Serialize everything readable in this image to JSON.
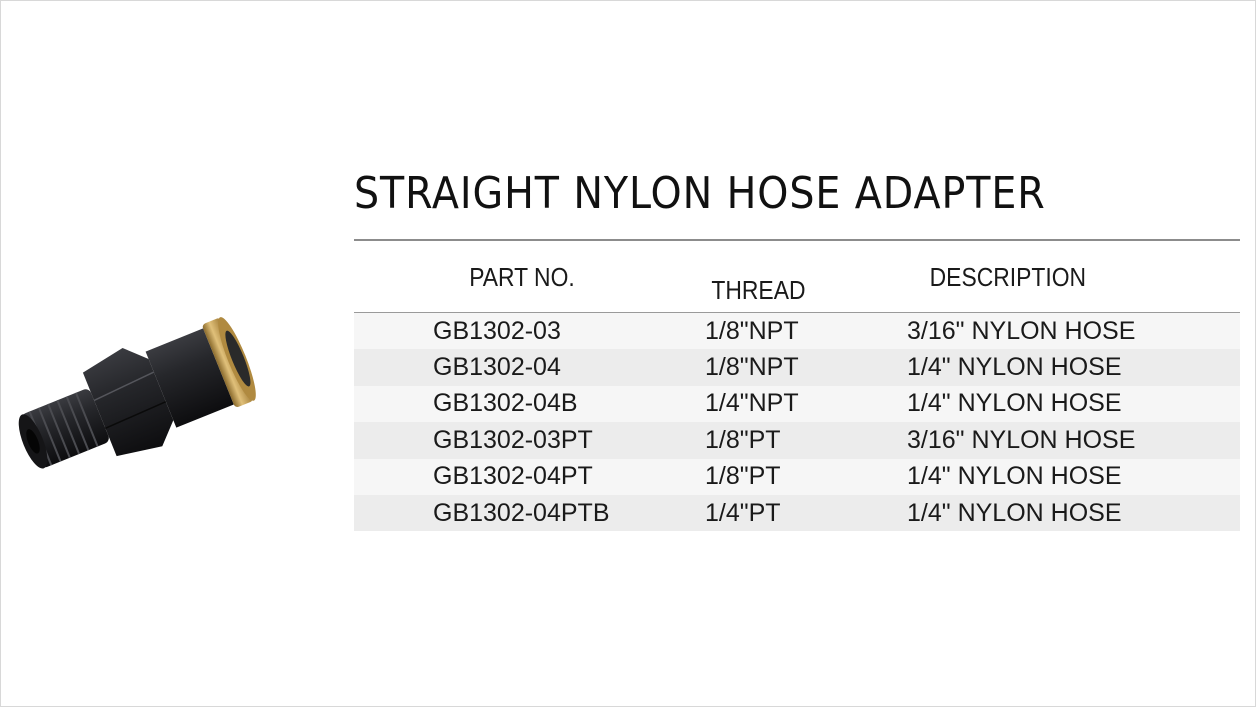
{
  "title": "STRAIGHT NYLON HOSE ADAPTER",
  "table": {
    "headers": {
      "part_no": "PART NO.",
      "thread": "THREAD",
      "description": "DESCRIPTION"
    },
    "rows": [
      {
        "part_no": "GB1302-03",
        "thread": "1/8\"NPT",
        "description": "3/16\" NYLON HOSE"
      },
      {
        "part_no": "GB1302-04",
        "thread": "1/8\"NPT",
        "description": "1/4\" NYLON HOSE"
      },
      {
        "part_no": "GB1302-04B",
        "thread": "1/4\"NPT",
        "description": "1/4\" NYLON HOSE"
      },
      {
        "part_no": "GB1302-03PT",
        "thread": "1/8\"PT",
        "description": "3/16\" NYLON HOSE"
      },
      {
        "part_no": "GB1302-04PT",
        "thread": "1/8\"PT",
        "description": "1/4\" NYLON HOSE"
      },
      {
        "part_no": "GB1302-04PTB",
        "thread": "1/4\"PT",
        "description": "1/4\" NYLON HOSE"
      }
    ]
  },
  "colors": {
    "fitting_body": "#1c1c1e",
    "brass_collar": "#c9a256",
    "row_light": "#f6f6f6",
    "row_dark": "#ececec"
  }
}
